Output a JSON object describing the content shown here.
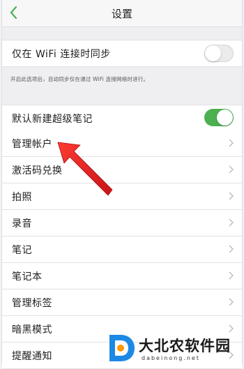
{
  "header": {
    "title": "设置",
    "back_icon": "chevron-left-icon",
    "accent": "#4caf50"
  },
  "sync_wifi": {
    "label": "仅在 WiFi 连接时同步",
    "enabled": false,
    "hint": "开启此选项后，自动同步仅在通过 WiFi 连接网络时进行。"
  },
  "super_note": {
    "label": "默认新建超级笔记",
    "enabled": true
  },
  "menu": {
    "items": [
      {
        "label": "管理帐户"
      },
      {
        "label": "激活码兑换"
      },
      {
        "label": "拍照"
      },
      {
        "label": "录音"
      },
      {
        "label": "笔记"
      },
      {
        "label": "笔记本"
      },
      {
        "label": "管理标签"
      },
      {
        "label": "暗黑模式"
      },
      {
        "label": "提醒通知"
      }
    ]
  },
  "annotation": {
    "arrow_color": "#e8231f"
  },
  "watermark": {
    "text": "大北农软件园",
    "sub": "dabeinong.net"
  }
}
